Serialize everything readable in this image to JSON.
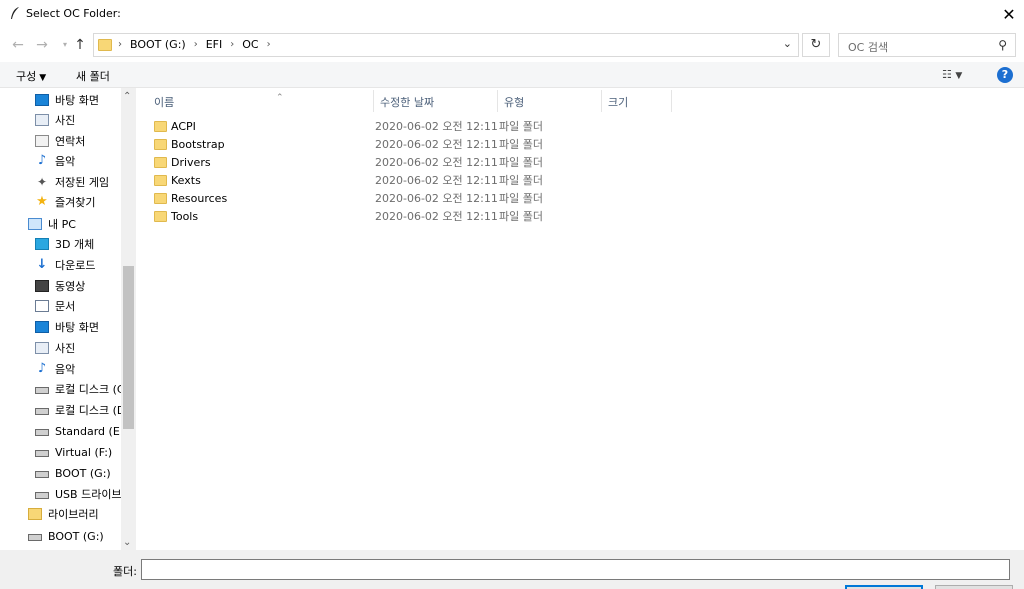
{
  "window": {
    "title": "Select OC Folder:"
  },
  "address": {
    "crumbs": [
      "BOOT (G:)",
      "EFI",
      "OC"
    ]
  },
  "search": {
    "placeholder": "OC 검색"
  },
  "toolbar": {
    "organize": "구성",
    "new_folder": "새 폴더"
  },
  "columns": {
    "name": "이름",
    "date": "수정한 날짜",
    "type": "유형",
    "size": "크기"
  },
  "sidebar": {
    "items": [
      {
        "label": "바탕 화면",
        "icon": "monitor-icon"
      },
      {
        "label": "사진",
        "icon": "picture-icon"
      },
      {
        "label": "연락처",
        "icon": "contact-icon"
      },
      {
        "label": "음악",
        "icon": "music-icon"
      },
      {
        "label": "저장된 게임",
        "icon": "game-icon"
      },
      {
        "label": "즐겨찾기",
        "icon": "star-icon"
      },
      {
        "label": "내 PC",
        "icon": "pc-icon"
      },
      {
        "label": "3D 개체",
        "icon": "cube-icon"
      },
      {
        "label": "다운로드",
        "icon": "download-icon"
      },
      {
        "label": "동영상",
        "icon": "film-icon"
      },
      {
        "label": "문서",
        "icon": "document-icon"
      },
      {
        "label": "바탕 화면",
        "icon": "monitor-icon"
      },
      {
        "label": "사진",
        "icon": "picture-icon"
      },
      {
        "label": "음악",
        "icon": "music-icon"
      },
      {
        "label": "로컬 디스크 (C",
        "icon": "drive-icon"
      },
      {
        "label": "로컬 디스크 (D",
        "icon": "drive-icon"
      },
      {
        "label": "Standard (E:)",
        "icon": "drive-icon"
      },
      {
        "label": "Virtual (F:)",
        "icon": "drive-icon"
      },
      {
        "label": "BOOT (G:)",
        "icon": "drive-icon"
      },
      {
        "label": "USB 드라이브",
        "icon": "drive-icon"
      },
      {
        "label": "라이브러리",
        "icon": "library-icon"
      },
      {
        "label": "BOOT (G:)",
        "icon": "drive-icon"
      }
    ]
  },
  "files": [
    {
      "name": "ACPI",
      "date": "2020-06-02 오전 12:11",
      "type": "파일 폴더"
    },
    {
      "name": "Bootstrap",
      "date": "2020-06-02 오전 12:11",
      "type": "파일 폴더"
    },
    {
      "name": "Drivers",
      "date": "2020-06-02 오전 12:11",
      "type": "파일 폴더"
    },
    {
      "name": "Kexts",
      "date": "2020-06-02 오전 12:11",
      "type": "파일 폴더"
    },
    {
      "name": "Resources",
      "date": "2020-06-02 오전 12:11",
      "type": "파일 폴더"
    },
    {
      "name": "Tools",
      "date": "2020-06-02 오전 12:11",
      "type": "파일 폴더"
    }
  ],
  "footer": {
    "folder_label": "폴더:",
    "folder_value": ""
  }
}
